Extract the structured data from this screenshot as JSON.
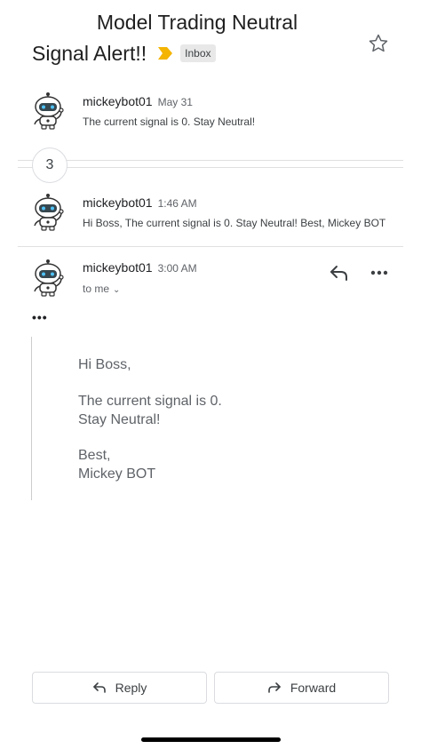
{
  "thread": {
    "subject_line1": "Model Trading Neutral",
    "subject_line2": "Signal Alert!!",
    "label": "Inbox",
    "importance_color": "#f4b400",
    "icons": {
      "importance": "importance-marker-icon",
      "star": "star-outline-icon"
    }
  },
  "messages": [
    {
      "sender": "mickeybot01",
      "time": "May 31",
      "snippet": "The current signal is 0. Stay Neutral!"
    },
    {
      "sender": "mickeybot01",
      "time": "1:46 AM",
      "snippet": "Hi Boss, The current signal is 0. Stay Neutral! Best, Mickey BOT"
    }
  ],
  "collapsed": {
    "count": "3"
  },
  "open_message": {
    "sender": "mickeybot01",
    "time": "3:00 AM",
    "recipient": "to me",
    "quoted_toggle": "•••",
    "body": {
      "greeting": "Hi Boss,",
      "line1": "The current signal is 0.",
      "line2": "Stay Neutral!",
      "signoff": "Best,",
      "signature": "Mickey BOT"
    },
    "icons": {
      "reply": "reply-arrow-icon",
      "more": "more-horizontal-icon"
    }
  },
  "actions": {
    "reply": "Reply",
    "forward": "Forward"
  }
}
